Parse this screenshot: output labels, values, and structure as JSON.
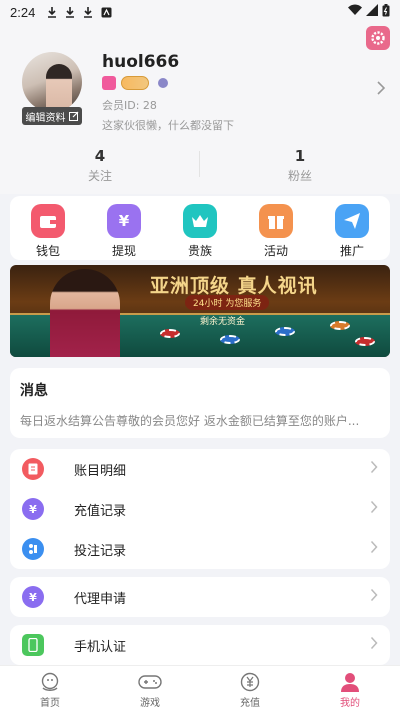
{
  "status_bar": {
    "time": "2:24"
  },
  "profile": {
    "username": "huol666",
    "member_id": "会员ID: 28",
    "bio": "这家伙很懒，什么都没留下",
    "edit_label": "编辑资料"
  },
  "stats": [
    {
      "count": "4",
      "label": "关注"
    },
    {
      "count": "1",
      "label": "粉丝"
    }
  ],
  "quick_actions": [
    {
      "label": "钱包",
      "icon": "wallet-icon",
      "color": "#f35a6e"
    },
    {
      "label": "提现",
      "icon": "money-bag-icon",
      "color": "#9a72f0"
    },
    {
      "label": "贵族",
      "icon": "crown-icon",
      "color": "#20c5c0"
    },
    {
      "label": "活动",
      "icon": "gift-icon",
      "color": "#f4924e"
    },
    {
      "label": "推广",
      "icon": "paper-plane-icon",
      "color": "#4aa3f5"
    }
  ],
  "banner": {
    "title": "亚洲顶级 真人视讯",
    "subtitle": "24小时 为您服务",
    "tagline": "剩余无资金"
  },
  "messages": {
    "heading": "消息",
    "text": "每日返水结算公告尊敬的会员您好  返水金额已结算至您的账户..."
  },
  "menu_group_1": [
    {
      "label": "账目明细",
      "icon": "ledger-icon",
      "color": "#f25b60"
    },
    {
      "label": "充值记录",
      "icon": "recharge-icon",
      "color": "#8a6df0"
    },
    {
      "label": "投注记录",
      "icon": "bet-record-icon",
      "color": "#3b8ff0"
    }
  ],
  "menu_group_2": [
    {
      "label": "代理申请",
      "icon": "agent-icon",
      "color": "#8a6df0"
    }
  ],
  "menu_group_3": [
    {
      "label": "手机认证",
      "icon": "phone-icon",
      "color": "#4cc75d"
    }
  ],
  "tabbar": [
    {
      "label": "首页",
      "icon": "home-icon"
    },
    {
      "label": "游戏",
      "icon": "gamepad-icon"
    },
    {
      "label": "充值",
      "icon": "yuan-icon"
    },
    {
      "label": "我的",
      "icon": "user-icon",
      "active": true
    }
  ],
  "colors": {
    "accent": "#e24e7a",
    "background": "#f2f3f7"
  }
}
